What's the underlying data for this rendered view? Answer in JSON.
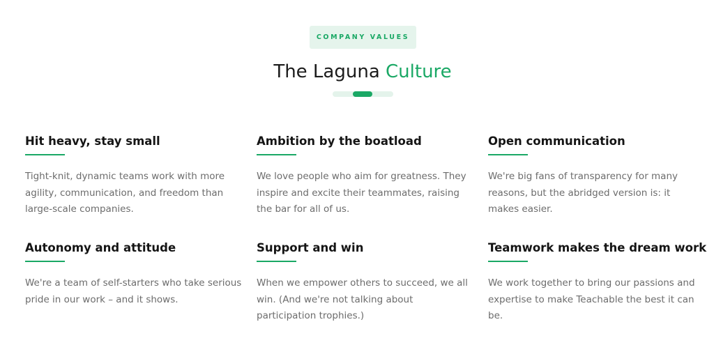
{
  "eyebrow": "COMPANY VALUES",
  "title": {
    "main": "The Laguna ",
    "accent": "Culture"
  },
  "colors": {
    "accent": "#1aa865",
    "accent_light": "#e5f4ec",
    "heading": "#151515",
    "body": "#6c6c6c"
  },
  "values": [
    {
      "heading": "Hit heavy, stay small",
      "text": "Tight-knit, dynamic teams work with more agility, communication, and freedom than large-scale companies."
    },
    {
      "heading": "Ambition by the boatload",
      "text": "We love people who aim for greatness. They inspire and excite their teammates, raising the bar for all of us."
    },
    {
      "heading": "Open communication",
      "text": "We're big fans of transparency for many reasons, but the abridged version is: it makes easier."
    },
    {
      "heading": "Autonomy and attitude",
      "text": "We're a team of self-starters who take serious pride in our work – and it shows."
    },
    {
      "heading": "Support and win",
      "text": "When we empower others to succeed, we all win. (And we're not talking about participation trophies.)"
    },
    {
      "heading": "Teamwork makes the dream work",
      "text": "We work together to bring our passions and expertise to make Teachable the best it can be."
    }
  ]
}
